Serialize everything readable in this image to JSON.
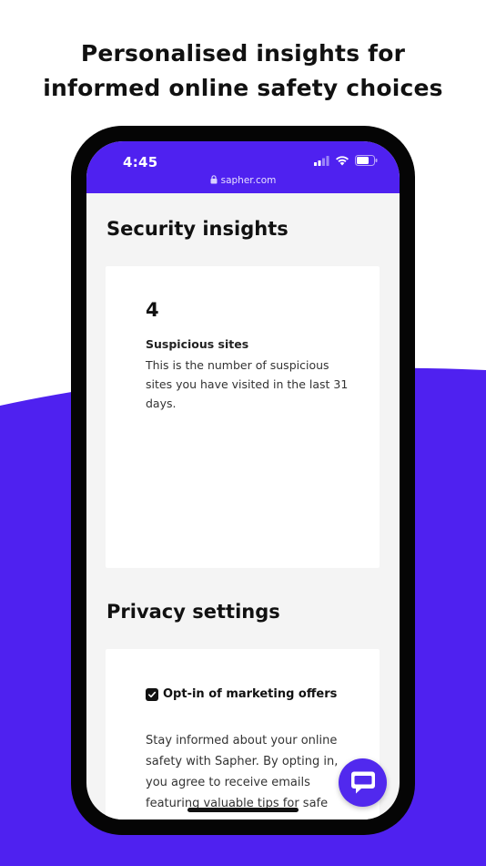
{
  "headline": {
    "line1": "Personalised insights for",
    "line2": "informed online safety choices"
  },
  "colors": {
    "brand": "#4f21f0",
    "background": "#ffffff",
    "screen_bg": "#f4f4f4",
    "phone_frame": "#050505"
  },
  "statusbar": {
    "time": "4:45",
    "url": "sapher.com",
    "icons": [
      "signal-icon",
      "wifi-icon",
      "battery-icon"
    ]
  },
  "security": {
    "title": "Security insights",
    "stat_value": "4",
    "stat_title": "Suspicious sites",
    "stat_description": "This is the number of suspicious sites you have visited in the last 31 days."
  },
  "privacy": {
    "title": "Privacy settings",
    "optin_label": "Opt-in of marketing offers",
    "optin_checked": true,
    "optin_description": "Stay informed about your online safety with Sapher. By opting in, you agree to receive emails featuring valuable tips for safe"
  },
  "chat": {
    "icon": "chat-bubble-icon"
  }
}
